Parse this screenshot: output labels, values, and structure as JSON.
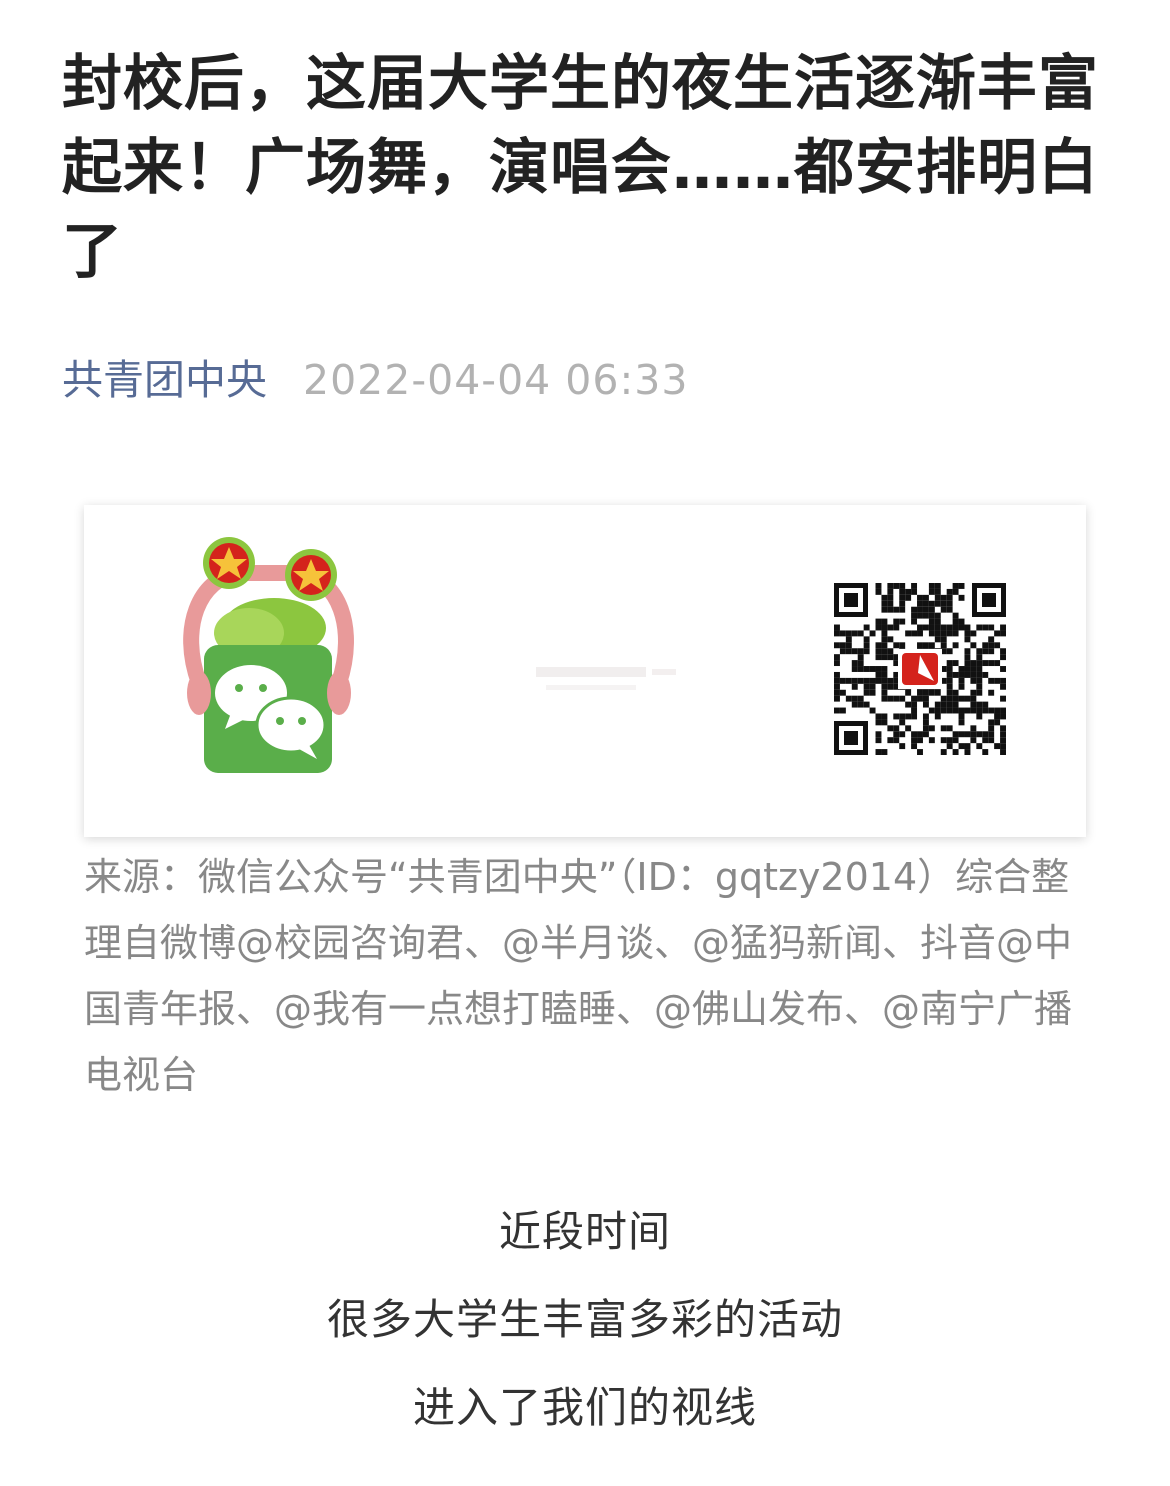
{
  "article": {
    "title": "封校后，这届大学生的夜生活逐渐丰富起来！广场舞，演唱会……都安排明白了",
    "account_name": "共青团中央",
    "publish_time": "2022-04-04 06:33"
  },
  "banner": {
    "mascot_icon": "wechat-mascot-icon",
    "qr_icon": "qr-code-icon",
    "colors": {
      "wechat_green": "#5aae4a",
      "mascot_pink": "#e89a9a",
      "leaf_green": "#8cc63f",
      "star_red": "#d4231c",
      "star_yellow": "#f6c23a"
    }
  },
  "source_text": "来源：微信公众号“共青团中央”（ID：gqtzy2014）综合整理自微博@校园咨询君、@半月谈、@猛犸新闻、抖音@中国青年报、@我有一点想打瞌睡、@佛山发布、@南宁广播电视台",
  "body": {
    "lines": [
      "近段时间",
      "很多大学生丰富多彩的活动",
      "进入了我们的视线"
    ]
  }
}
